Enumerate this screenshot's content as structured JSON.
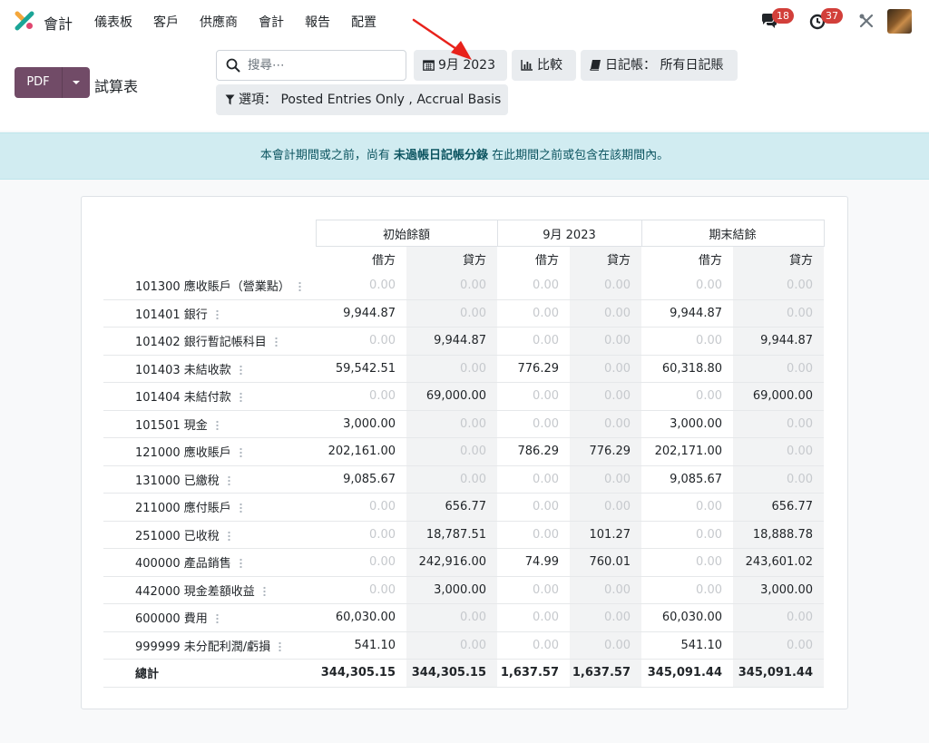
{
  "nav": {
    "app_name": "會計",
    "menu": [
      "儀表板",
      "客戶",
      "供應商",
      "會計",
      "報告",
      "配置"
    ],
    "messages_count": "18",
    "activities_count": "37"
  },
  "control": {
    "pdf_label": "PDF",
    "breadcrumb": "試算表",
    "search_placeholder": "搜尋⋯",
    "date_filter": "9月 2023",
    "compare_label": "比較",
    "journal_filter": "日記帳： 所有日記賬",
    "options_filter": "選項： Posted Entries Only , Accrual Basis"
  },
  "alert": {
    "prefix": "本會計期間或之前，尚有 ",
    "link": "未過帳日記帳分錄",
    "suffix": " 在此期間之前或包含在該期間內。"
  },
  "report": {
    "group_headers": [
      "初始餘額",
      "9月 2023",
      "期末結餘"
    ],
    "sub_headers": [
      "借方",
      "貸方",
      "借方",
      "貸方",
      "借方",
      "貸方"
    ],
    "rows": [
      {
        "account": "101300 應收賬戶（營業點）",
        "values": [
          "0.00",
          "0.00",
          "0.00",
          "0.00",
          "0.00",
          "0.00"
        ]
      },
      {
        "account": "101401 銀行",
        "values": [
          "9,944.87",
          "0.00",
          "0.00",
          "0.00",
          "9,944.87",
          "0.00"
        ]
      },
      {
        "account": "101402 銀行暫記帳科目",
        "values": [
          "0.00",
          "9,944.87",
          "0.00",
          "0.00",
          "0.00",
          "9,944.87"
        ]
      },
      {
        "account": "101403 未結收款",
        "values": [
          "59,542.51",
          "0.00",
          "776.29",
          "0.00",
          "60,318.80",
          "0.00"
        ]
      },
      {
        "account": "101404 未結付款",
        "values": [
          "0.00",
          "69,000.00",
          "0.00",
          "0.00",
          "0.00",
          "69,000.00"
        ]
      },
      {
        "account": "101501 現金",
        "values": [
          "3,000.00",
          "0.00",
          "0.00",
          "0.00",
          "3,000.00",
          "0.00"
        ]
      },
      {
        "account": "121000 應收賬戶",
        "values": [
          "202,161.00",
          "0.00",
          "786.29",
          "776.29",
          "202,171.00",
          "0.00"
        ]
      },
      {
        "account": "131000 已繳稅",
        "values": [
          "9,085.67",
          "0.00",
          "0.00",
          "0.00",
          "9,085.67",
          "0.00"
        ]
      },
      {
        "account": "211000 應付賬戶",
        "values": [
          "0.00",
          "656.77",
          "0.00",
          "0.00",
          "0.00",
          "656.77"
        ]
      },
      {
        "account": "251000 已收稅",
        "values": [
          "0.00",
          "18,787.51",
          "0.00",
          "101.27",
          "0.00",
          "18,888.78"
        ]
      },
      {
        "account": "400000 產品銷售",
        "values": [
          "0.00",
          "242,916.00",
          "74.99",
          "760.01",
          "0.00",
          "243,601.02"
        ]
      },
      {
        "account": "442000 現金差額收益",
        "values": [
          "0.00",
          "3,000.00",
          "0.00",
          "0.00",
          "0.00",
          "3,000.00"
        ]
      },
      {
        "account": "600000 費用",
        "values": [
          "60,030.00",
          "0.00",
          "0.00",
          "0.00",
          "60,030.00",
          "0.00"
        ]
      },
      {
        "account": "999999 未分配利潤/虧損",
        "values": [
          "541.10",
          "0.00",
          "0.00",
          "0.00",
          "541.10",
          "0.00"
        ]
      }
    ],
    "total": {
      "label": "總計",
      "values": [
        "344,305.15",
        "344,305.15",
        "1,637.57",
        "1,637.57",
        "345,091.44",
        "345,091.44"
      ]
    }
  },
  "colors": {
    "brand": "#714b67",
    "badge": "#d23f3a",
    "alert_bg": "#d1ecf1",
    "alert_text": "#0c5460",
    "zero_value": "#c6c9cd",
    "annotation_arrow": "#e8221b"
  }
}
